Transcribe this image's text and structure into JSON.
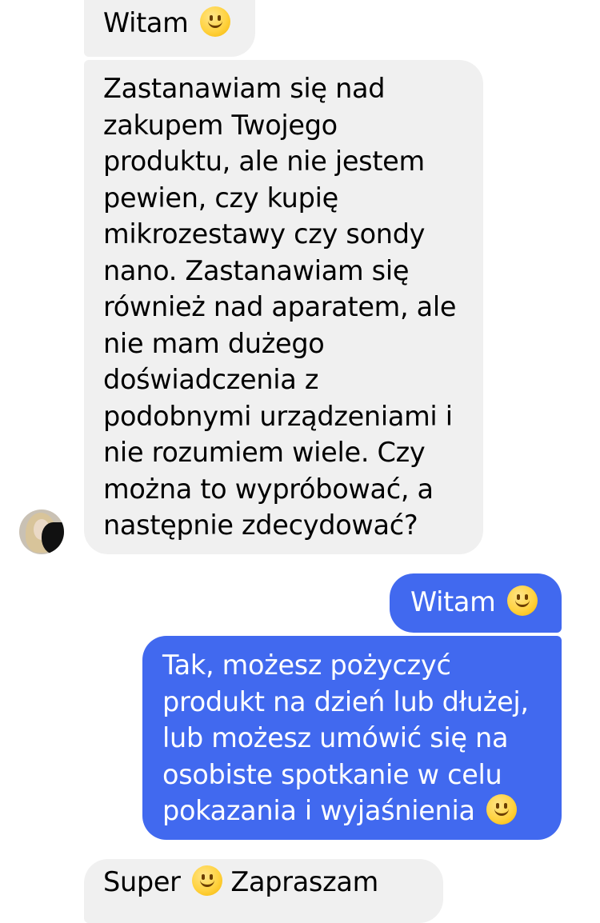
{
  "conversation": {
    "messages": [
      {
        "sender": "contact",
        "lines": [
          "Witam"
        ],
        "emoji": "slightly-smiling-face-icon"
      },
      {
        "sender": "contact",
        "lines": [
          "Zastanawiam się nad",
          "zakupem Twojego",
          "produktu, ale nie jestem",
          "pewien, czy kupię",
          "mikrozestawy czy sondy",
          "nano. Zastanawiam się",
          "również nad aparatem, ale",
          "nie mam dużego",
          "doświadczenia z",
          "podobnymi urządzeniami i",
          "nie rozumiem wiele. Czy",
          "można to wypróbować, a",
          "następnie zdecydować?"
        ]
      },
      {
        "sender": "me",
        "lines": [
          "Witam"
        ],
        "emoji": "slightly-smiling-face-icon"
      },
      {
        "sender": "me",
        "lines": [
          "Tak, możesz pożyczyć",
          "produkt na dzień lub dłużej,",
          "lub możesz umówić się na",
          "osobiste spotkanie w celu",
          "pokazania i wyjaśnienia"
        ],
        "emoji": "slightly-smiling-face-icon"
      },
      {
        "sender": "contact",
        "lines": [
          "Super",
          "Zapraszam"
        ],
        "emoji": "slightly-smiling-face-icon"
      }
    ]
  },
  "colors": {
    "incoming_bubble": "#f0f0f0",
    "outgoing_bubble": "#4169ef",
    "outgoing_text": "#ffffff",
    "incoming_text": "#000000"
  }
}
